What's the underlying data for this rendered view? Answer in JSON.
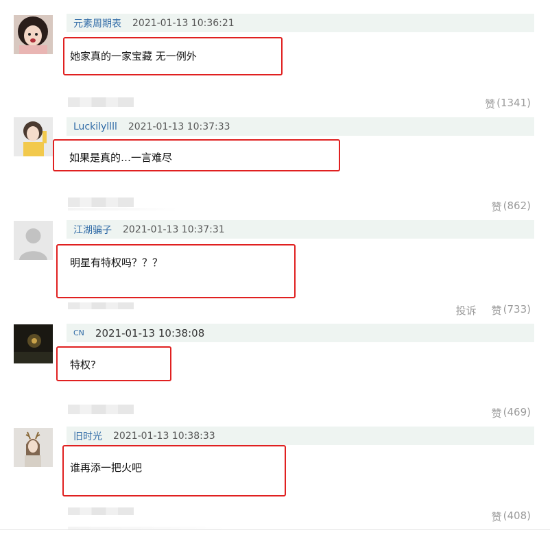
{
  "comments": [
    {
      "username": "元素周期表",
      "timestamp": "2021-01-13 10:36:21",
      "text": "她家真的一家宝藏 无一例外",
      "like_label": "赞",
      "like_count": "(1341)"
    },
    {
      "username": "Luckilyllll",
      "timestamp": "2021-01-13 10:37:33",
      "text": "如果是真的…一言难尽",
      "like_label": "赞",
      "like_count": "(862)"
    },
    {
      "username": "江湖骗子",
      "timestamp": "2021-01-13 10:37:31",
      "text": "明星有特权吗？？？",
      "report_label": "投诉",
      "like_label": "赞",
      "like_count": "(733)"
    },
    {
      "username": "CN",
      "timestamp": "2021-01-13 10:38:08",
      "text": "特权?",
      "like_label": "赞",
      "like_count": "(469)"
    },
    {
      "username": "旧时光",
      "timestamp": "2021-01-13 10:38:33",
      "text": "谁再添一把火吧",
      "like_label": "赞",
      "like_count": "(408)"
    }
  ],
  "colors": {
    "username": "#2f6aa6",
    "highlight_border": "#e02020",
    "meta_bar_bg": "#eef4f1",
    "action_text": "#9a9a9a"
  }
}
